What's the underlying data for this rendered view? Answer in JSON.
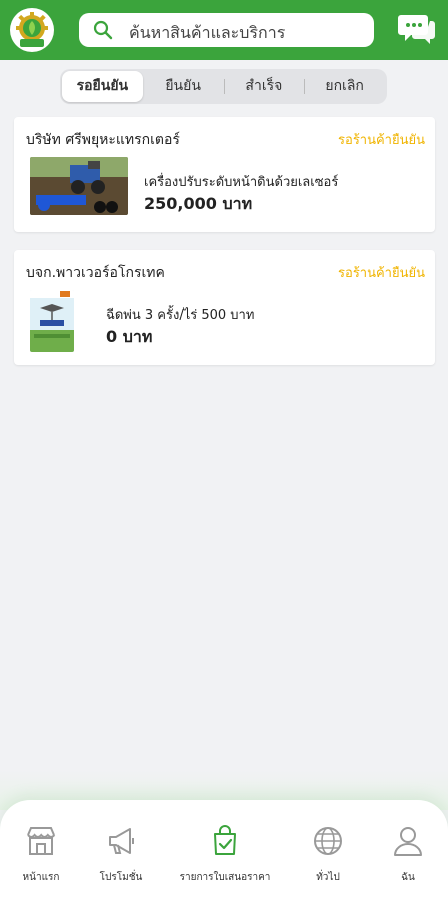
{
  "header": {
    "search_placeholder": "ค้นหาสินค้าและบริการ"
  },
  "tabs": [
    {
      "label": "รอยืนยัน",
      "active": true
    },
    {
      "label": "ยืนยัน",
      "active": false
    },
    {
      "label": "สำเร็จ",
      "active": false
    },
    {
      "label": "ยกเลิก",
      "active": false
    }
  ],
  "orders": [
    {
      "company": "บริษัท ศรีพยุหะแทรกเตอร์",
      "status": "รอร้านค้ายืนยัน",
      "product": "เครื่องปรับระดับหน้าดินด้วยเลเซอร์",
      "price": "250,000 บาท"
    },
    {
      "company": "บจก.พาวเวอร์อโกรเทค",
      "status": "รอร้านค้ายืนยัน",
      "product": "ฉีดพ่น 3 ครั้ง/ไร่ 500 บาท",
      "price": "0 บาท"
    }
  ],
  "nav": [
    {
      "label": "หน้าแรก",
      "icon": "store-icon"
    },
    {
      "label": "โปรโมชั่น",
      "icon": "megaphone-icon"
    },
    {
      "label": "รายการใบเสนอราคา",
      "icon": "shopping-bag-check-icon",
      "active": true
    },
    {
      "label": "ทั่วไป",
      "icon": "globe-icon"
    },
    {
      "label": "ฉัน",
      "icon": "user-icon"
    }
  ],
  "colors": {
    "brand_green": "#3ba43c",
    "status_yellow": "#f0b400"
  }
}
